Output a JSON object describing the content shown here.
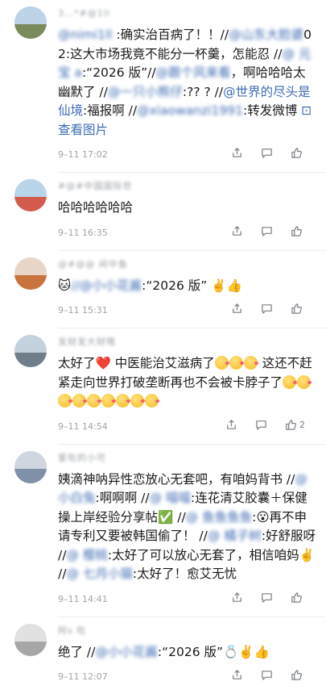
{
  "comments": [
    {
      "name": "3…*#@1ll",
      "segments": [
        {
          "t": "@",
          "cls": "blur"
        },
        {
          "t": "nimi1ll ",
          "cls": "blur"
        },
        {
          "t": ":确实治百病了！！//"
        },
        {
          "t": "@山东大脸婆",
          "cls": "blur"
        },
        {
          "t": "02:这大市场我竟不能分一杯羹，怎能忍 //"
        },
        {
          "t": "@ 元宝 ",
          "cls": "blur"
        },
        {
          "t": "a",
          "cls": "blur"
        },
        {
          "t": ":“2026 版”//"
        },
        {
          "t": "@跟个风来看",
          "cls": "blur"
        },
        {
          "t": "，啊哈哈哈太幽默了 //"
        },
        {
          "t": "@一只小熊仔",
          "cls": "blur"
        },
        {
          "t": ":?? ? //"
        },
        {
          "t": "@世界的尽头是仙境",
          "cls": "mention"
        },
        {
          "t": ":福报啊 //"
        },
        {
          "t": "@xiaowanzi1991",
          "cls": "blur"
        },
        {
          "t": ":转发微博 "
        },
        {
          "t": "⊡ 查看图片",
          "cls": "mention"
        }
      ],
      "time": "9–11 17:02",
      "likes": ""
    },
    {
      "name": "#@#中国国际世",
      "segments": [
        {
          "t": "哈哈哈哈哈哈"
        }
      ],
      "time": "9–11 16:35",
      "likes": ""
    },
    {
      "name": "@#@@ 闲中鱼",
      "segments": [
        {
          "t": "🐱"
        },
        {
          "t": "//@小小花酱",
          "cls": "blur"
        },
        {
          "t": ":“2026 版” ✌️👍"
        }
      ],
      "time": "9–11 15:31",
      "likes": ""
    },
    {
      "name": "发财发大财哦",
      "segments": [
        {
          "t": "太好了"
        },
        {
          "t": "❤️",
          "cls": "heart"
        },
        {
          "t": " 中医能治艾滋病了"
        },
        {
          "t": "EMO3"
        },
        {
          "t": " 这还不赶紧走向世界打破垄断再也不会被卡脖子了"
        },
        {
          "t": "EMO9"
        }
      ],
      "time": "9–11 14:54",
      "likes": "2"
    },
    {
      "name": "爱吃的小可",
      "segments": [
        {
          "t": "姨滴神呐异性恋放心无套吧，有咱妈背书 //"
        },
        {
          "t": "@ 小白兔",
          "cls": "blur"
        },
        {
          "t": ":啊啊啊 //"
        },
        {
          "t": "@ 喵喵",
          "cls": "blur"
        },
        {
          "t": ":连花清艾胶囊＋保健操上岸经验分享帖✅ //"
        },
        {
          "t": "@ 鱼鱼鱼鱼",
          "cls": "blur"
        },
        {
          "t": ":😮再不申请专利又要被韩国偷了！ //"
        },
        {
          "t": "@ 橘子树",
          "cls": "blur"
        },
        {
          "t": ":好舒服呀 //"
        },
        {
          "t": "@ 樱桃",
          "cls": "blur"
        },
        {
          "t": ":太好了可以放心无套了，相信咱妈✌️ //"
        },
        {
          "t": "@ 七月小猫",
          "cls": "blur"
        },
        {
          "t": ":太好了！愈艾无忧"
        }
      ],
      "time": "9–11 14:41",
      "likes": ""
    },
    {
      "name": "阿s 吃",
      "segments": [
        {
          "t": "绝了 //"
        },
        {
          "t": "@小小花酱",
          "cls": "blur"
        },
        {
          "t": ":“2026 版”💍✌️👍"
        }
      ],
      "time": "9–11 12:07",
      "likes": ""
    }
  ],
  "icons": {
    "share": "share-icon",
    "comment": "comment-icon",
    "like": "like-icon"
  },
  "colors": {
    "link": "#3d6bb3",
    "time": "#a0a4a8",
    "divider": "#eceef0"
  }
}
